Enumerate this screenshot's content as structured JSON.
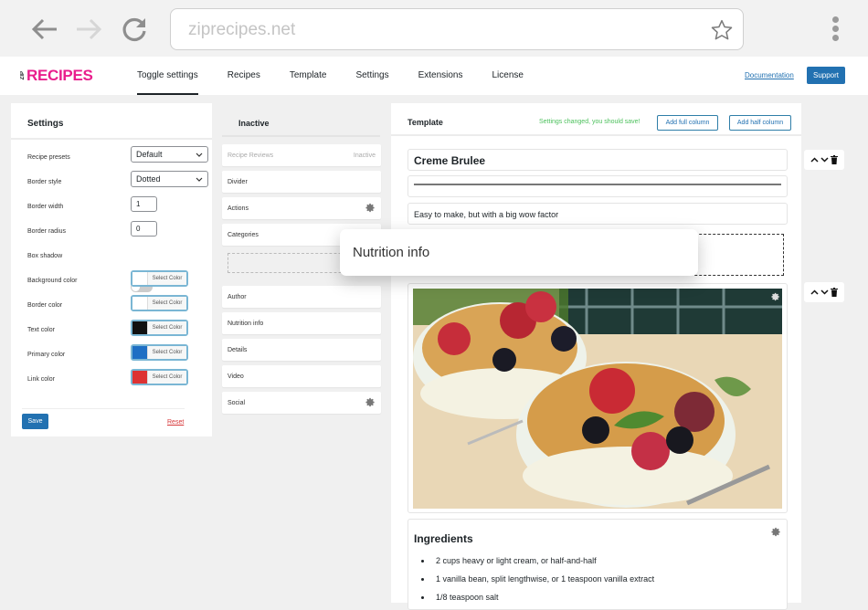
{
  "browser": {
    "url": "ziprecipes.net",
    "icons": {
      "back": "arrow-left-icon",
      "forward": "arrow-right-icon",
      "reload": "reload-icon",
      "bookmark": "star-icon",
      "menu": "kebab-menu-icon"
    }
  },
  "header": {
    "logo_prefix": "ZIP",
    "logo_text": "RECIPES",
    "tabs": [
      {
        "label": "Toggle settings",
        "active": true
      },
      {
        "label": "Recipes"
      },
      {
        "label": "Template"
      },
      {
        "label": "Settings"
      },
      {
        "label": "Extensions"
      },
      {
        "label": "License"
      }
    ],
    "documentation_label": "Documentation",
    "support_label": "Support"
  },
  "settings": {
    "title": "Settings",
    "recipe_presets": {
      "label": "Recipe presets",
      "value": "Default"
    },
    "border_style": {
      "label": "Border style",
      "value": "Dotted"
    },
    "border_width": {
      "label": "Border width",
      "value": "1"
    },
    "border_radius": {
      "label": "Border radius",
      "value": "0"
    },
    "box_shadow": {
      "label": "Box shadow",
      "enabled": false
    },
    "colors": [
      {
        "label": "Background color",
        "button": "Select Color",
        "color": "#ffffff"
      },
      {
        "label": "Border color",
        "button": "Select Color",
        "color": "#ffffff"
      },
      {
        "label": "Text color",
        "button": "Select Color",
        "color": "#111111"
      },
      {
        "label": "Primary color",
        "button": "Select Color",
        "color": "#1e6fc4"
      },
      {
        "label": "Link color",
        "button": "Select Color",
        "color": "#dd3333"
      }
    ],
    "save_label": "Save",
    "reset_label": "Reset"
  },
  "inactive": {
    "title": "Inactive",
    "items": [
      {
        "label": "Recipe Reviews",
        "status": "Inactive"
      },
      {
        "label": "Divider"
      },
      {
        "label": "Actions",
        "gear": true
      },
      {
        "label": "Categories"
      },
      {
        "label": "Author"
      },
      {
        "label": "Nutrition info"
      },
      {
        "label": "Details"
      },
      {
        "label": "Video"
      },
      {
        "label": "Social",
        "gear": true
      }
    ]
  },
  "template": {
    "title": "Template",
    "status_message": "Settings changed, you should save!",
    "add_full_column": "Add full column",
    "add_half_column": "Add half column",
    "recipe_title": "Creme Brulee",
    "description": "Easy to make, but with a big wow factor",
    "ingredients_title": "Ingredients",
    "ingredients": [
      "2 cups heavy or light cream, or half-and-half",
      "1 vanilla bean, split lengthwise, or 1 teaspoon vanilla extract",
      "1/8 teaspoon salt"
    ],
    "image_alt": "Creme brulee with berries and mint"
  },
  "drag_tooltip": "Nutrition info",
  "row_controls": {
    "up": "chevron-up-icon",
    "down": "chevron-down-icon",
    "delete": "trash-icon"
  }
}
